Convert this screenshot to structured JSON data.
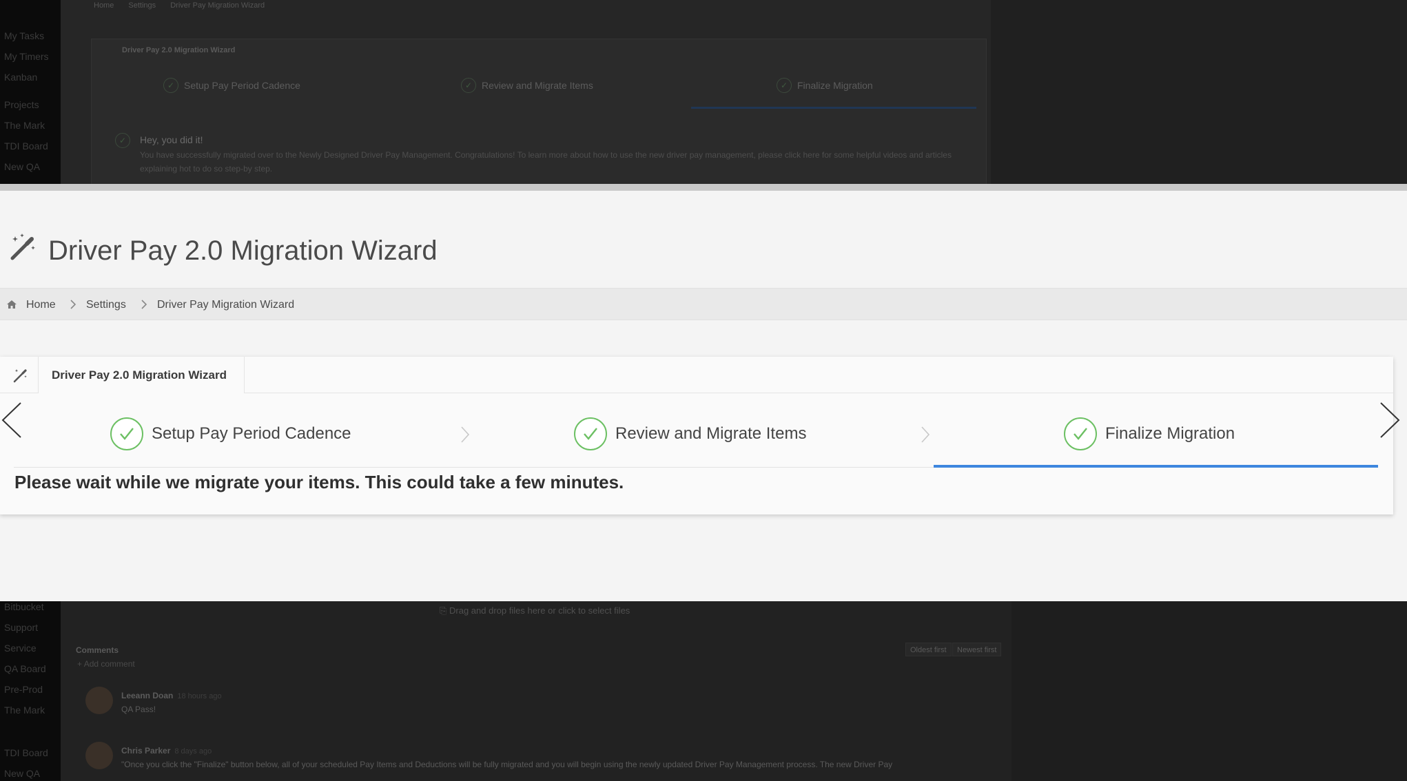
{
  "background_top": {
    "sidebar_items": [
      "My Tasks",
      "My Timers",
      "Kanban",
      "Projects",
      "The Mark",
      "TDI Board",
      "New QA"
    ],
    "breadcrumb": [
      "Home",
      "Settings",
      "Driver Pay Migration Wizard"
    ],
    "panel_title": "Driver Pay 2.0 Migration Wizard",
    "steps": [
      "Setup Pay Period Cadence",
      "Review and Migrate Items",
      "Finalize Migration"
    ],
    "success_title": "Hey, you did it!",
    "success_body": "You have successfully migrated over to the Newly Designed Driver Pay Management. Congratulations! To learn more about how to use the new driver pay management, please click here for some helpful videos and articles explaining hot to do so step-by step."
  },
  "page": {
    "title": "Driver Pay 2.0 Migration Wizard",
    "title_icon": "magic-wand-icon"
  },
  "breadcrumb": {
    "home_icon": "home-icon",
    "items": [
      "Home",
      "Settings",
      "Driver Pay Migration Wizard"
    ]
  },
  "panel": {
    "tab_icon": "magic-wand-icon",
    "tab_label": "Driver Pay 2.0 Migration Wizard",
    "steps": [
      {
        "label": "Setup Pay Period Cadence",
        "status": "complete"
      },
      {
        "label": "Review and Migrate Items",
        "status": "complete"
      },
      {
        "label": "Finalize Migration",
        "status": "active"
      }
    ],
    "message": "Please wait while we migrate your items. This could take a few minutes."
  },
  "colors": {
    "accent_blue": "#3d86de",
    "check_green": "#6cc063"
  },
  "background_bottom": {
    "sidebar_items": [
      "Bitbucket",
      "Support",
      "Service",
      "QA Board",
      "Pre-Prod",
      "The Mark",
      "TDI Board",
      "New QA"
    ],
    "dropzone": "Drag and drop files here or click to select files",
    "comments_heading": "Comments",
    "sort_oldest": "Oldest first",
    "sort_newest": "Newest first",
    "add_comment": "Add comment",
    "comments": [
      {
        "author": "Leeann Doan",
        "time": "18 hours ago",
        "text": "QA Pass!"
      },
      {
        "author": "Chris Parker",
        "time": "8 days ago",
        "text": "\"Once you click the \"Finalize\" button below, all of your scheduled Pay Items and Deductions will be fully migrated and you will begin using the newly updated Driver Pay Management process. The new Driver Pay"
      }
    ]
  }
}
